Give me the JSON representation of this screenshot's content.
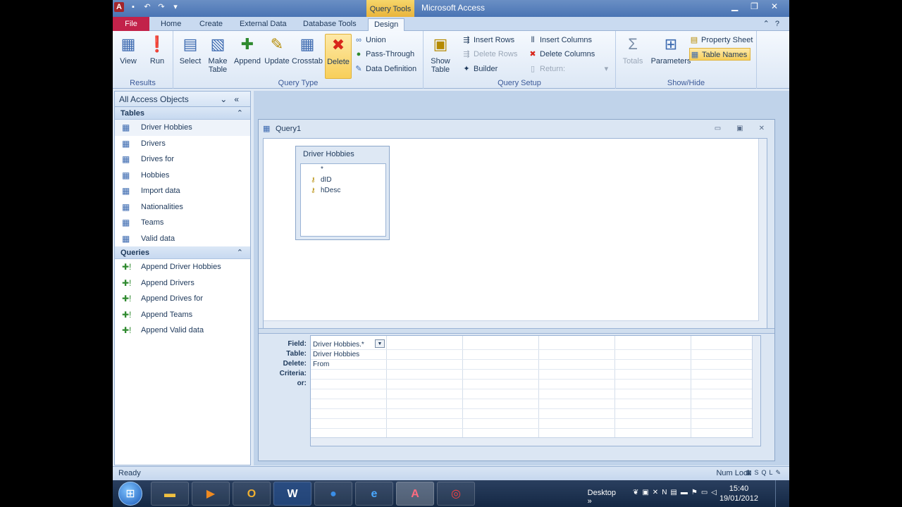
{
  "app": {
    "window_title": "Microsoft Access",
    "context_tab": "Query Tools"
  },
  "tabs": [
    "File",
    "Home",
    "Create",
    "External Data",
    "Database Tools",
    "Design"
  ],
  "ribbon": {
    "results": {
      "label": "Results",
      "view": "View",
      "run": "Run"
    },
    "query_type": {
      "label": "Query Type",
      "select": "Select",
      "make_table_1": "Make",
      "make_table_2": "Table",
      "append": "Append",
      "update": "Update",
      "crosstab": "Crosstab",
      "delete": "Delete",
      "union": "Union",
      "pass_through": "Pass-Through",
      "data_definition": "Data Definition"
    },
    "query_setup": {
      "label": "Query Setup",
      "show_table_1": "Show",
      "show_table_2": "Table",
      "insert_rows": "Insert Rows",
      "delete_rows": "Delete Rows",
      "builder": "Builder",
      "insert_columns": "Insert Columns",
      "delete_columns": "Delete Columns",
      "return": "Return:"
    },
    "show_hide": {
      "label": "Show/Hide",
      "totals": "Totals",
      "parameters": "Parameters",
      "property_sheet": "Property Sheet",
      "table_names": "Table Names"
    }
  },
  "nav": {
    "header": "All Access Objects",
    "tables_label": "Tables",
    "tables": [
      "Driver Hobbies",
      "Drivers",
      "Drives for",
      "Hobbies",
      "Import data",
      "Nationalities",
      "Teams",
      "Valid data"
    ],
    "queries_label": "Queries",
    "queries": [
      "Append Driver Hobbies",
      "Append Drivers",
      "Append Drives for",
      "Append Teams",
      "Append Valid data"
    ]
  },
  "query_window": {
    "title": "Query1",
    "table": {
      "name": "Driver Hobbies",
      "fields": [
        "*",
        "dID",
        "hDesc"
      ]
    },
    "grid": {
      "row_labels": [
        "Field:",
        "Table:",
        "Delete:",
        "Criteria:",
        "or:"
      ],
      "column1": {
        "field": "Driver Hobbies.*",
        "table": "Driver Hobbies",
        "delete": "From"
      }
    }
  },
  "status": {
    "left": "Ready",
    "right": "Num Lock",
    "view_sql": "SQL"
  },
  "taskbar": {
    "desktop": "Desktop",
    "time": "15:40",
    "date": "19/01/2012"
  }
}
